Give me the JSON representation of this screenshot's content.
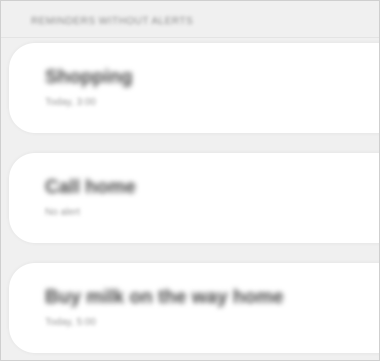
{
  "header": {
    "label": "Reminders without alerts"
  },
  "reminders": [
    {
      "title": "Shopping",
      "subtitle": "Today, 3:00"
    },
    {
      "title": "Call home",
      "subtitle": "No alert"
    },
    {
      "title": "Buy milk on the way home",
      "subtitle": "Today, 5:00"
    }
  ]
}
